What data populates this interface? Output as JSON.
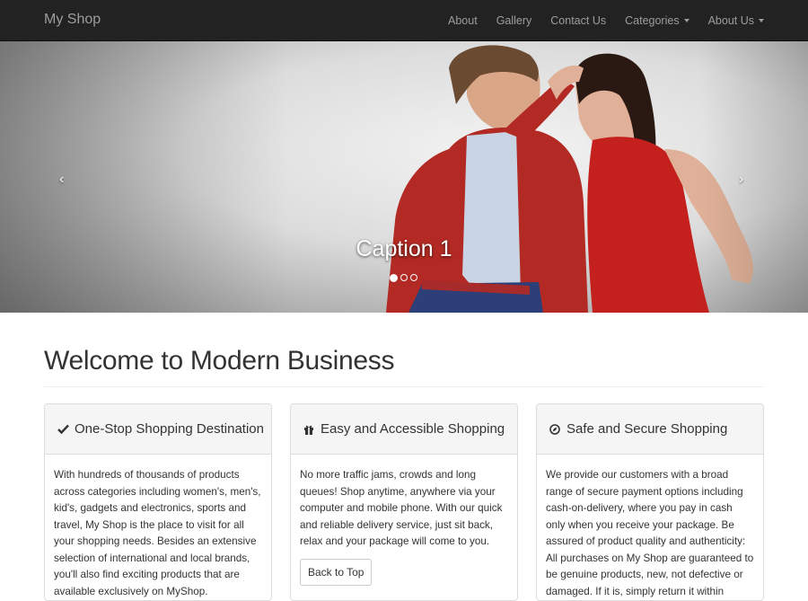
{
  "navbar": {
    "brand": "My Shop",
    "items": [
      {
        "label": "About",
        "dropdown": false
      },
      {
        "label": "Gallery",
        "dropdown": false
      },
      {
        "label": "Contact Us",
        "dropdown": false
      },
      {
        "label": "Categories",
        "dropdown": true
      },
      {
        "label": "About Us",
        "dropdown": true
      }
    ]
  },
  "carousel": {
    "caption": "Caption 1",
    "prev_icon": "‹",
    "next_icon": "›",
    "slide_count": 3,
    "active_slide": 1
  },
  "main": {
    "heading": "Welcome to Modern Business",
    "panels": [
      {
        "icon": "check-icon",
        "title": "One-Stop Shopping Destination",
        "body": "With hundreds of thousands of products across categories including women's, men's, kid's, gadgets and electronics, sports and travel, My Shop is the place to visit for all your shopping needs. Besides an extensive selection of international and local brands, you'll also find exciting products that are available exclusively on MyShop."
      },
      {
        "icon": "gift-icon",
        "title": "Easy and Accessible Shopping",
        "body": "No more traffic jams, crowds and long queues! Shop anytime, anywhere via your computer and mobile phone. With our quick and reliable delivery service, just sit back, relax and your package will come to you.",
        "button": "Back to Top"
      },
      {
        "icon": "compass-icon",
        "title": "Safe and Secure Shopping",
        "body": "We provide our customers with a broad range of secure payment options including cash-on-delivery, where you pay in cash only when you receive your package. Be assured of product quality and authenticity: All purchases on My Shop are guaranteed to be genuine products, new, not defective or damaged. If it is, simply return it within"
      }
    ]
  },
  "colors": {
    "navbar_bg": "#222222",
    "nav_text": "#9d9d9d",
    "panel_head_bg": "#f5f5f5",
    "border": "#dddddd"
  }
}
